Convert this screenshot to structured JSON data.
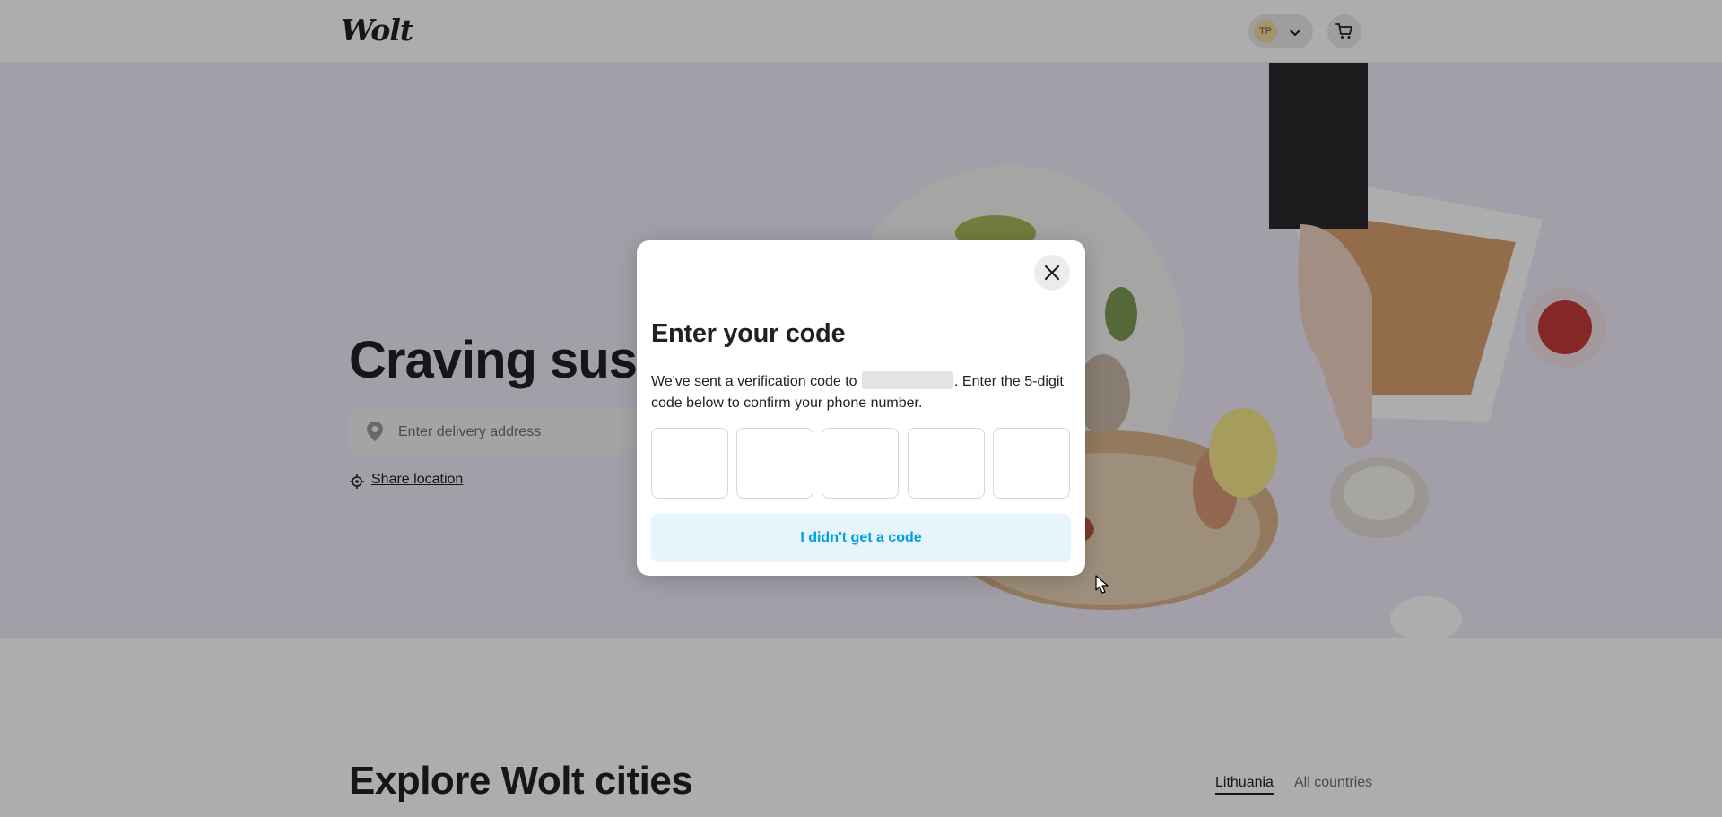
{
  "header": {
    "logo_text": "Wolt",
    "user_initials": "TP"
  },
  "hero": {
    "title": "Craving sushi?",
    "address_placeholder": "Enter delivery address",
    "share_location_label": "Share location"
  },
  "explore": {
    "title": "Explore Wolt cities",
    "tabs": [
      {
        "label": "Lithuania",
        "active": true
      },
      {
        "label": "All countries",
        "active": false
      }
    ]
  },
  "modal": {
    "title": "Enter your code",
    "desc_before": "We've sent a verification code to ",
    "desc_after": ". Enter the 5-digit code below to confirm your phone number.",
    "code_digits": [
      "",
      "",
      "",
      "",
      ""
    ],
    "no_code_label": "I didn't get a code"
  },
  "colors": {
    "brand": "#009de0",
    "brand_light": "#e6f5fc",
    "text": "#202125",
    "hero_bg": "#efeafa"
  }
}
